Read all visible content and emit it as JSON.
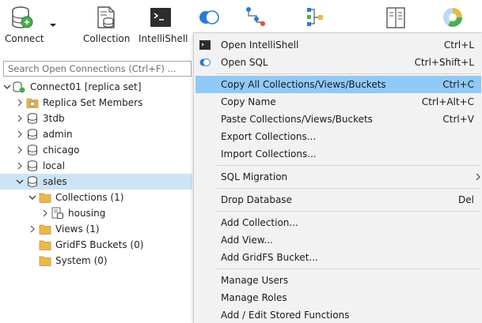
{
  "toolbar": {
    "connect": "Connect",
    "collection": "Collection",
    "intellishell": "IntelliShell"
  },
  "search": {
    "placeholder": "Search Open Connections (Ctrl+F) ..."
  },
  "tree": {
    "connection": "Connect01 [replica set]",
    "replica": "Replica Set Members",
    "db_3tdb": "3tdb",
    "db_admin": "admin",
    "db_chicago": "chicago",
    "db_local": "local",
    "db_sales": "sales",
    "collections": "Collections (1)",
    "housing": "housing",
    "views": "Views (1)",
    "gridfs": "GridFS Buckets (0)",
    "system": "System (0)"
  },
  "menu": {
    "open_intellishell": "Open IntelliShell",
    "open_intellishell_key": "Ctrl+L",
    "open_sql": "Open SQL",
    "open_sql_key": "Ctrl+Shift+L",
    "copy_all": "Copy All Collections/Views/Buckets",
    "copy_all_key": "Ctrl+C",
    "copy_name": "Copy Name",
    "copy_name_key": "Ctrl+Alt+C",
    "paste": "Paste Collections/Views/Buckets",
    "paste_key": "Ctrl+V",
    "export": "Export Collections...",
    "import": "Import Collections...",
    "sql_migration": "SQL Migration",
    "drop_db": "Drop Database",
    "drop_db_key": "Del",
    "add_collection": "Add Collection...",
    "add_view": "Add View...",
    "add_gridfs": "Add GridFS Bucket...",
    "manage_users": "Manage Users",
    "manage_roles": "Manage Roles",
    "stored_functions": "Add / Edit Stored Functions"
  },
  "colors": {
    "selection": "#cce4f7",
    "menu_highlight": "#91c9f7",
    "menu_bg": "#f2f2f2",
    "folder": "#e8b84a",
    "accent_green": "#4caf50",
    "accent_blue": "#2b7bd6"
  },
  "icons": {
    "connect": "database-plug-icon",
    "collection": "document-db-icon",
    "intellishell": "terminal-icon",
    "sql": "sql-toggle-icon",
    "aggregate": "pipeline-icon",
    "schema": "schema-tree-icon",
    "report": "report-icon",
    "chart": "pie-chart-icon"
  }
}
